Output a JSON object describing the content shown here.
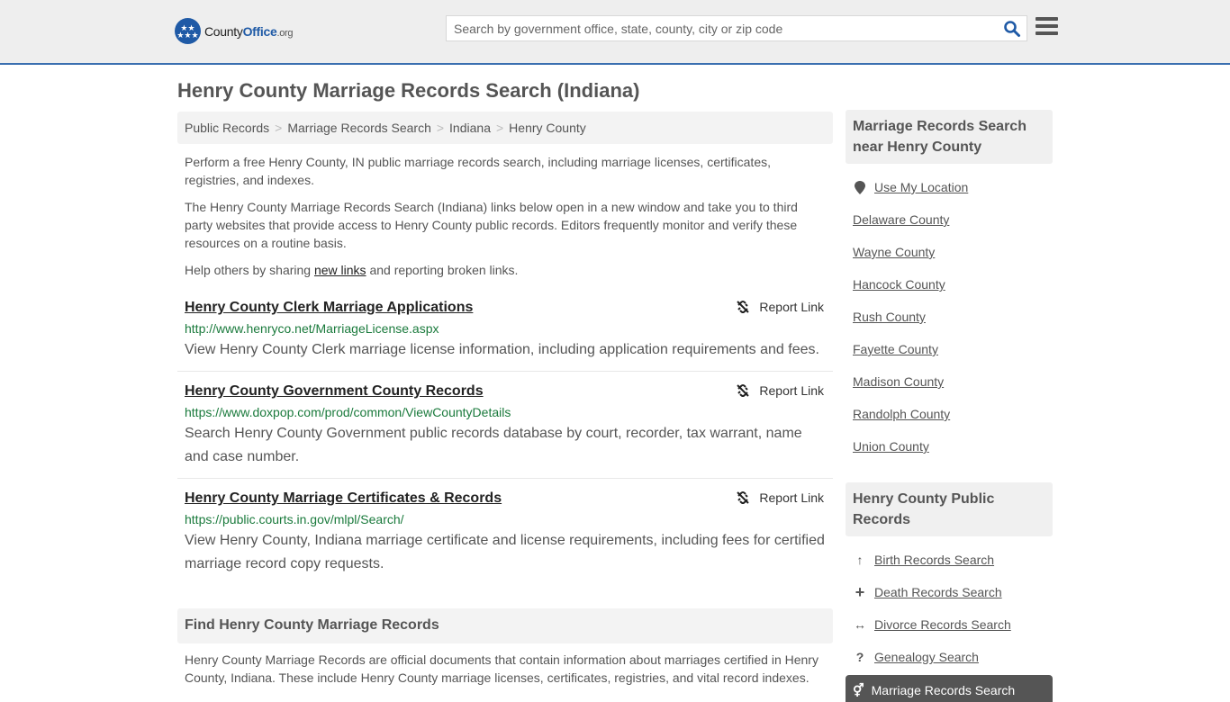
{
  "header": {
    "logo": {
      "name_part1": "County",
      "name_part2": "Office",
      "name_part3": ".org"
    },
    "search": {
      "placeholder": "Search by government office, state, county, city or zip code",
      "value": ""
    },
    "colors": {
      "brand": "#1f5aa6",
      "link_green": "#1a7a3c",
      "header_bg": "#eeeeee"
    }
  },
  "page": {
    "title": "Henry County Marriage Records Search (Indiana)",
    "breadcrumb": [
      {
        "label": "Public Records"
      },
      {
        "label": "Marriage Records Search"
      },
      {
        "label": "Indiana"
      },
      {
        "label": "Henry County"
      }
    ],
    "intro": {
      "p1": "Perform a free Henry County, IN public marriage records search, including marriage licenses, certificates, registries, and indexes.",
      "p2": "The Henry County Marriage Records Search (Indiana) links below open in a new window and take you to third party websites that provide access to Henry County public records. Editors frequently monitor and verify these resources on a routine basis.",
      "p3_before": "Help others by sharing ",
      "p3_link": "new links",
      "p3_after": " and reporting broken links."
    },
    "results": [
      {
        "title": "Henry County Clerk Marriage Applications",
        "url": "http://www.henryco.net/MarriageLicense.aspx",
        "description": "View Henry County Clerk marriage license information, including application requirements and fees.",
        "report_label": "Report Link"
      },
      {
        "title": "Henry County Government County Records",
        "url": "https://www.doxpop.com/prod/common/ViewCountyDetails",
        "description": "Search Henry County Government public records database by court, recorder, tax warrant, name and case number.",
        "report_label": "Report Link"
      },
      {
        "title": "Henry County Marriage Certificates & Records",
        "url": "https://public.courts.in.gov/mlpl/Search/",
        "description": "View Henry County, Indiana marriage certificate and license requirements, including fees for certified marriage record copy requests.",
        "report_label": "Report Link"
      }
    ],
    "find_section": {
      "heading": "Find Henry County Marriage Records",
      "text": "Henry County Marriage Records are official documents that contain information about marriages certified in Henry County, Indiana. These include Henry County marriage licenses, certificates, registries, and vital record indexes."
    }
  },
  "sidebar": {
    "nearby": {
      "heading": "Marriage Records Search near Henry County",
      "items": [
        {
          "label": "Use My Location",
          "icon": "map-marker-icon"
        },
        {
          "label": "Delaware County"
        },
        {
          "label": "Wayne County"
        },
        {
          "label": "Hancock County"
        },
        {
          "label": "Rush County"
        },
        {
          "label": "Fayette County"
        },
        {
          "label": "Madison County"
        },
        {
          "label": "Randolph County"
        },
        {
          "label": "Union County"
        }
      ]
    },
    "public_records": {
      "heading": "Henry County Public Records",
      "items": [
        {
          "label": "Birth Records Search",
          "icon": "child-icon"
        },
        {
          "label": "Death Records Search",
          "icon": "plus-icon"
        },
        {
          "label": "Divorce Records Search",
          "icon": "arrows-horizontal-icon"
        },
        {
          "label": "Genealogy Search",
          "icon": "question-icon"
        }
      ],
      "active": {
        "label": "Marriage Records Search",
        "icon": "venus-mars-icon"
      }
    }
  }
}
